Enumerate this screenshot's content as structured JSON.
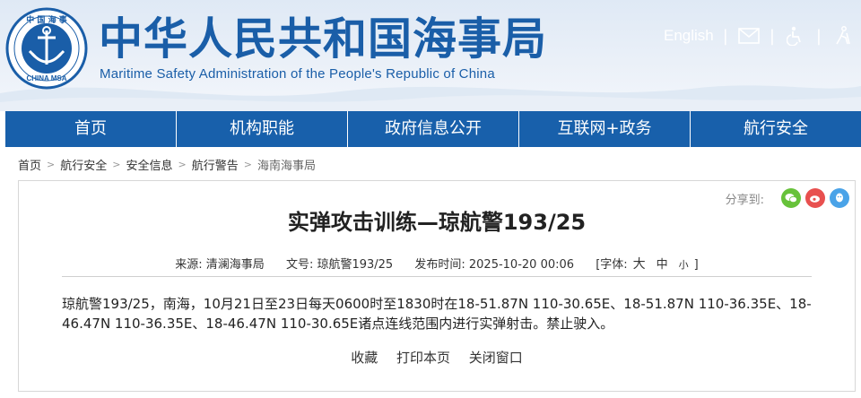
{
  "header": {
    "logo_text": "中国海事 CHINA MSA",
    "title": "中华人民共和国海事局",
    "subtitle": "Maritime Safety Administration of the People's Republic of China",
    "language_link": "English",
    "separator": "|",
    "icons": [
      "mail-icon",
      "accessibility-icon",
      "elder-care-icon"
    ]
  },
  "nav": {
    "items": [
      {
        "label": "首页"
      },
      {
        "label": "机构职能"
      },
      {
        "label": "政府信息公开"
      },
      {
        "label": "互联网+政务"
      },
      {
        "label": "航行安全"
      }
    ]
  },
  "breadcrumb": {
    "items": [
      "首页",
      "航行安全",
      "安全信息",
      "航行警告",
      "海南海事局"
    ],
    "separator": ">"
  },
  "share": {
    "label": "分享到:",
    "buttons": [
      {
        "name": "wechat-icon",
        "color": "#67c23a"
      },
      {
        "name": "weibo-icon",
        "color": "#e8504f"
      },
      {
        "name": "qq-icon",
        "color": "#4aa3e8"
      }
    ]
  },
  "article": {
    "title": "实弹攻击训练—琼航警193/25",
    "source_label": "来源:",
    "source": "清澜海事局",
    "doc_no_label": "文号:",
    "doc_no": "琼航警193/25",
    "publish_label": "发布时间:",
    "publish_time": "2025-10-20 00:06",
    "font_label": "[字体:",
    "font_big": "大",
    "font_mid": "中",
    "font_small": "小",
    "font_end": "]",
    "body": "琼航警193/25，南海，10月21日至23日每天0600时至1830时在18-51.87N 110-30.65E、18-51.87N 110-36.35E、18-46.47N 110-36.35E、18-46.47N 110-30.65E诸点连线范围内进行实弹射击。禁止驶入。"
  },
  "actions": {
    "favorite": "收藏",
    "print": "打印本页",
    "close": "关闭窗口"
  },
  "colors": {
    "brand_blue": "#1a5ea8",
    "nav_blue": "#1860ab"
  }
}
